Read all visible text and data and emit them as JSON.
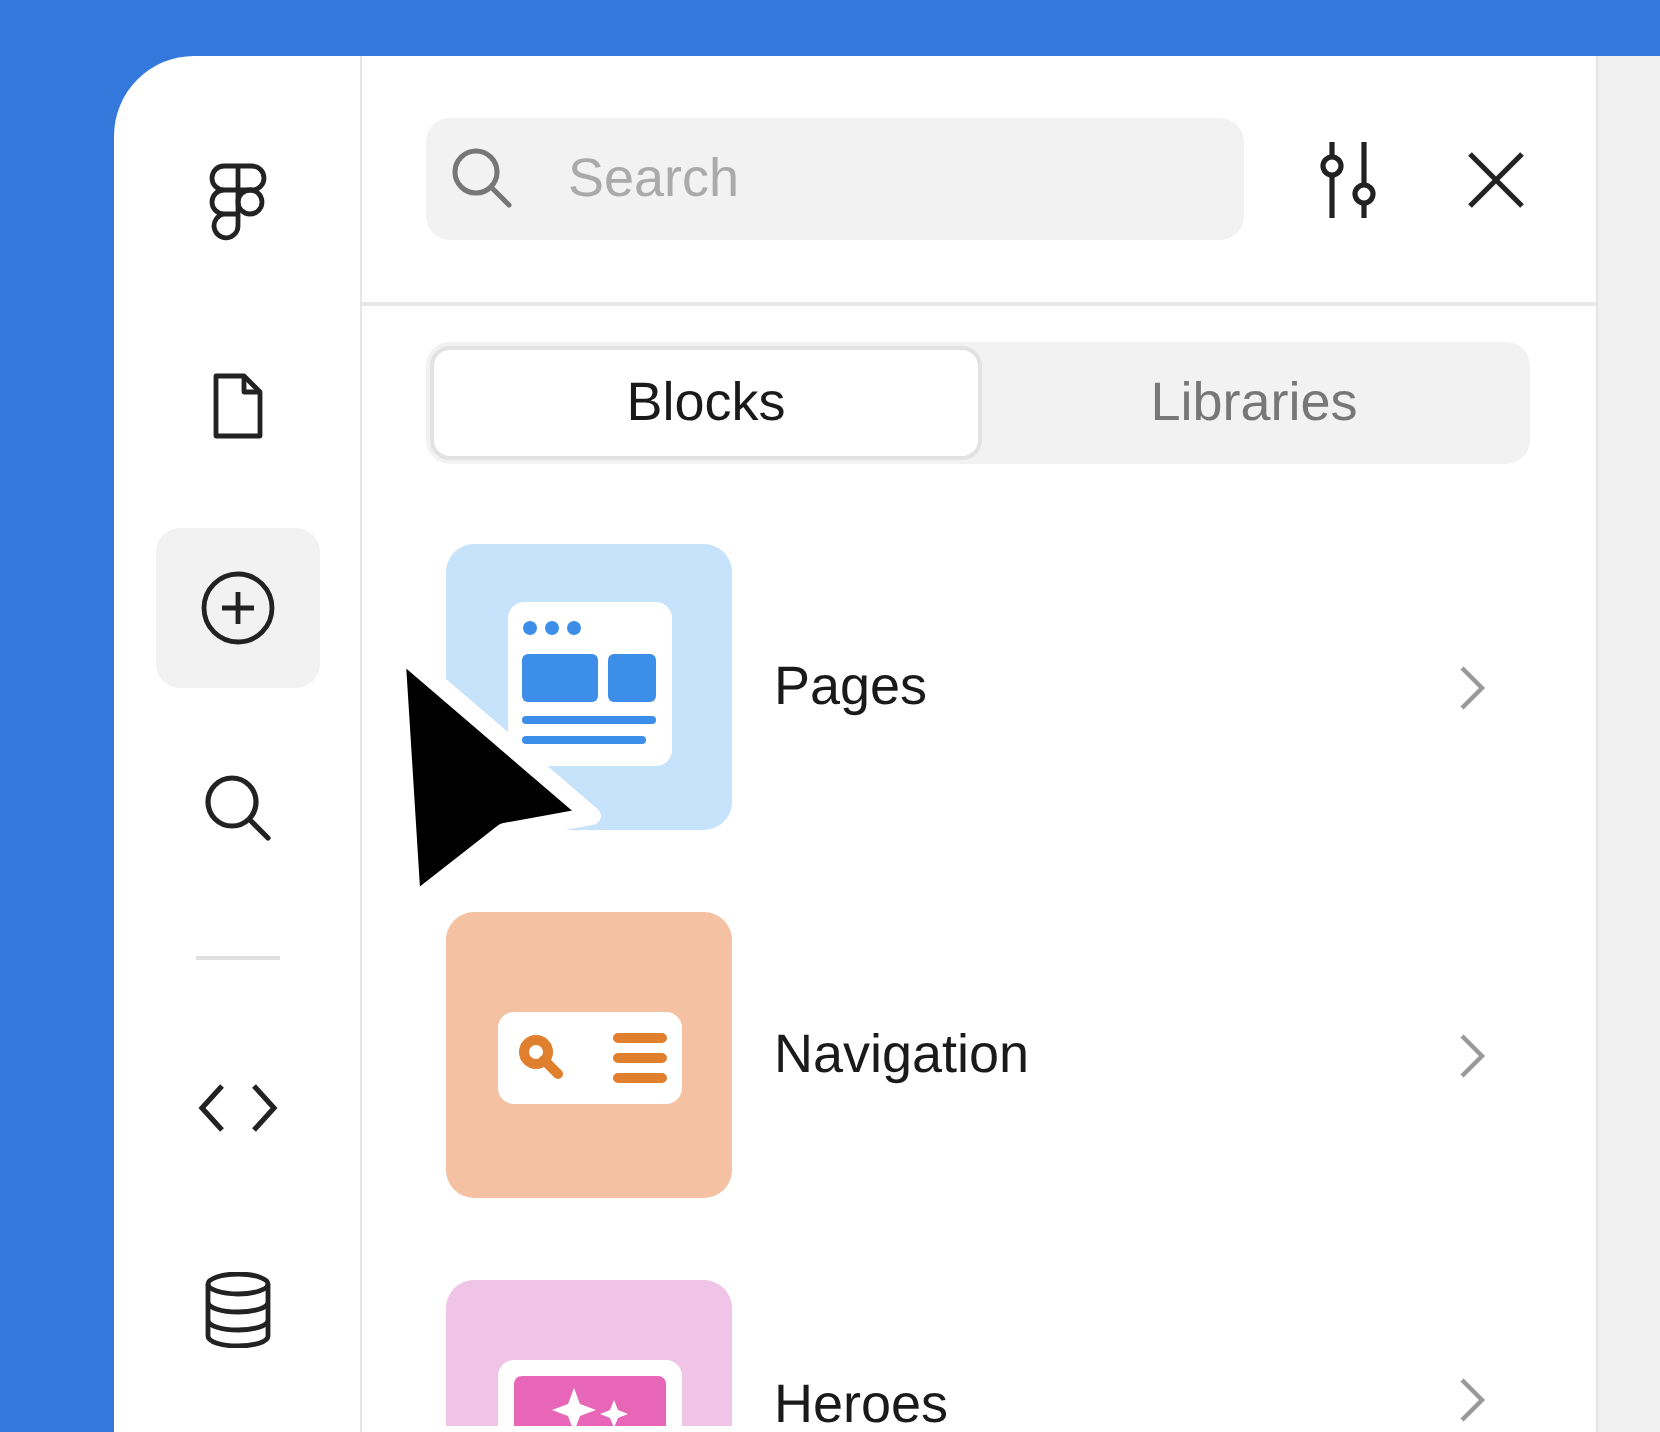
{
  "rail": {
    "top": [
      {
        "kind": "logo",
        "selected": false
      },
      {
        "kind": "file",
        "selected": false
      },
      {
        "kind": "add",
        "selected": true
      },
      {
        "kind": "search",
        "selected": false
      }
    ],
    "bottom": [
      {
        "kind": "code",
        "selected": false
      },
      {
        "kind": "database",
        "selected": false
      }
    ]
  },
  "search": {
    "placeholder": "Search"
  },
  "tabs": [
    {
      "label": "Blocks",
      "selected": true
    },
    {
      "label": "Libraries",
      "selected": false
    }
  ],
  "blocks": [
    {
      "kind": "pages",
      "label": "Pages"
    },
    {
      "kind": "navigation",
      "label": "Navigation"
    },
    {
      "kind": "heroes",
      "label": "Heroes"
    }
  ]
}
